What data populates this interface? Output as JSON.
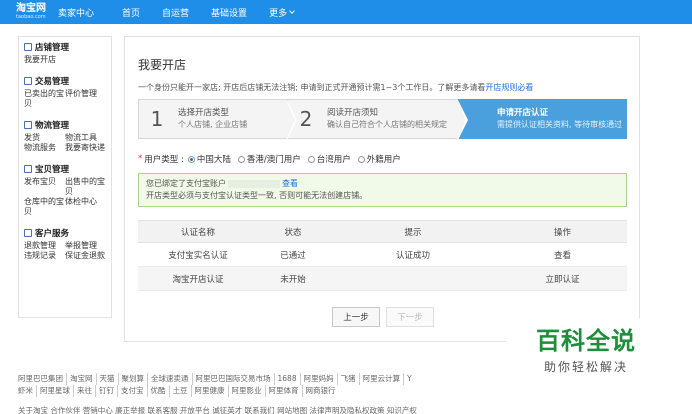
{
  "topnav": {
    "logo_main": "淘宝网",
    "logo_sub": "taobao.com",
    "seller_center": "卖家中心",
    "items": [
      "首页",
      "自运营",
      "基础设置"
    ],
    "more": "更多"
  },
  "sidebar": {
    "sections": [
      {
        "title": "店铺管理",
        "items": [
          "我要开店"
        ]
      },
      {
        "title": "交易管理",
        "items": [
          "已卖出的宝贝",
          "评价管理"
        ]
      },
      {
        "title": "物流管理",
        "items": [
          "发货",
          "物流工具",
          "物流服务",
          "我要寄快递"
        ]
      },
      {
        "title": "宝贝管理",
        "items": [
          "发布宝贝",
          "出售中的宝贝",
          "仓库中的宝贝",
          "体检中心"
        ]
      },
      {
        "title": "客户服务",
        "items": [
          "退款管理",
          "举报管理",
          "违规记录",
          "保证金退款"
        ]
      }
    ]
  },
  "main": {
    "title": "我要开店",
    "notice": "一个身份只能开一家店; 开店后店铺无法注销; 申请到正式开通预计需1~3个工作日。了解更多请看",
    "notice_link": "开店规则必看",
    "steps": [
      {
        "num": "1",
        "title": "选择开店类型",
        "desc": "个人店铺, 企业店铺"
      },
      {
        "num": "2",
        "title": "阅读开店须知",
        "desc": "确认自己符合个人店铺的相关规定"
      },
      {
        "num": "3",
        "title": "申请开店认证",
        "desc": "需提供认证相关资料, 等待审核通过"
      }
    ],
    "user_type_label": "用户类型 :",
    "user_types": [
      "中国大陆",
      "香港/澳门用户",
      "台湾用户",
      "外籍用户"
    ],
    "alert_line1_prefix": "您已绑定了支付宝账户",
    "alert_line1_link": "查看",
    "alert_line2": "开店类型必须与支付宝认证类型一致, 否则可能无法创建店铺。",
    "table": {
      "headers": [
        "认证名称",
        "状态",
        "提示",
        "操作"
      ],
      "rows": [
        {
          "name": "支付宝实名认证",
          "status": "已通过",
          "tip": "认证成功",
          "action": "查看"
        },
        {
          "name": "淘宝开店认证",
          "status": "未开始",
          "tip": "",
          "action": "立即认证"
        }
      ]
    },
    "prev_button": "上一步",
    "next_button": "下一步"
  },
  "footer": {
    "links": [
      "阿里巴巴集团",
      "淘宝网",
      "天猫",
      "聚划算",
      "全球速卖通",
      "阿里巴巴国际交易市场",
      "1688",
      "阿里妈妈",
      "飞猪",
      "阿里云计算",
      "Y"
    ],
    "links2": [
      "虾米",
      "阿里星球",
      "来往",
      "钉钉",
      "支付宝",
      "优酷",
      "土豆",
      "阿里健康",
      "阿里影业",
      "阿里体育",
      "网商银行"
    ],
    "line3": "关于淘宝  合作伙伴  营销中心  廉正举报  联系客服  开放平台  诚征英才  联系我们  网站地图  法律声明及隐私权政策  知识产权"
  },
  "watermark": {
    "line1": "百科全说",
    "line2": "助你轻松解决"
  }
}
